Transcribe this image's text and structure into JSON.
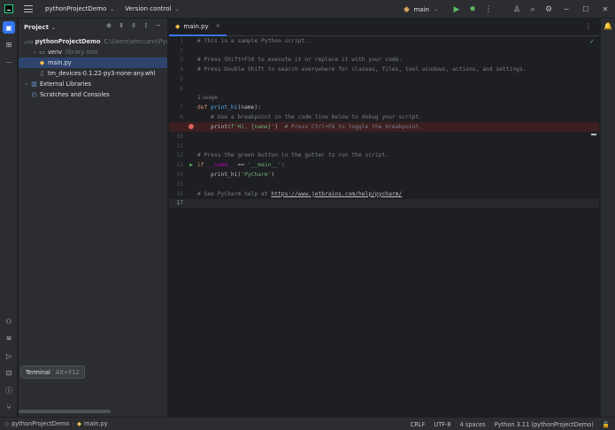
{
  "titlebar": {
    "project_name": "pythonProjectDemo",
    "vcs_label": "Version control",
    "run_config": "main"
  },
  "project_panel": {
    "title": "Project",
    "tree": [
      {
        "label": "pythonProjectDemo",
        "note": "C:\\Users\\amccann\\Pycha",
        "kind": "folder",
        "depth": 0,
        "expanded": true
      },
      {
        "label": "venv",
        "note": "library root",
        "kind": "folder",
        "depth": 1,
        "expanded": false
      },
      {
        "label": "main.py",
        "note": "",
        "kind": "python",
        "depth": 1,
        "selected": true
      },
      {
        "label": "tm_devices-0.1.22-py3-none-any.whl",
        "note": "",
        "kind": "file",
        "depth": 1
      },
      {
        "label": "External Libraries",
        "note": "",
        "kind": "library",
        "depth": 0,
        "expanded": false
      },
      {
        "label": "Scratches and Consoles",
        "note": "",
        "kind": "scratch",
        "depth": 0
      }
    ],
    "tooltip": {
      "label": "Terminal",
      "shortcut": "Alt+F12"
    }
  },
  "editor": {
    "tab_label": "main.py",
    "usage_hint": "1 usage",
    "lines": {
      "l1": "# This is a sample Python script.",
      "l3": "# Press Shift+F10 to execute it or replace it with your code.",
      "l4": "# Press Double Shift to search everywhere for classes, files, tool windows, actions, and settings.",
      "l7_kw": "def ",
      "l7_fn": "print_hi",
      "l7_rest": "(name):",
      "l8": "    # Use a breakpoint in the code line below to debug your script.",
      "l9_a": "    print(",
      "l9_s": "f'Hi, {name}'",
      "l9_b": ")  ",
      "l9_c": "# Press Ctrl+F8 to toggle the breakpoint.",
      "l12": "# Press the green button in the gutter to run the script.",
      "l13_kw": "if ",
      "l13_dn": "__name__",
      "l13_mid": " == ",
      "l13_s": "'__main__'",
      "l13_end": ":",
      "l14_a": "    print_hi(",
      "l14_s": "'PyCharm'",
      "l14_b": ")",
      "l16_c": "# See PyCharm help at ",
      "l16_url": "https://www.jetbrains.com/help/pycharm/"
    },
    "line_numbers": [
      "1",
      "2",
      "3",
      "4",
      "5",
      "6",
      "7",
      "8",
      "9",
      "10",
      "11",
      "12",
      "13",
      "14",
      "15",
      "16",
      "17"
    ]
  },
  "statusbar": {
    "crumb_project": "pythonProjectDemo",
    "crumb_file": "main.py",
    "line_sep": "CRLF",
    "encoding": "UTF-8",
    "indent": "4 spaces",
    "interpreter": "Python 3.11 (pythonProjectDemo)"
  },
  "colors": {
    "accent": "#3574f0",
    "breakpoint": "#db5c5c",
    "run_green": "#5fb865"
  }
}
